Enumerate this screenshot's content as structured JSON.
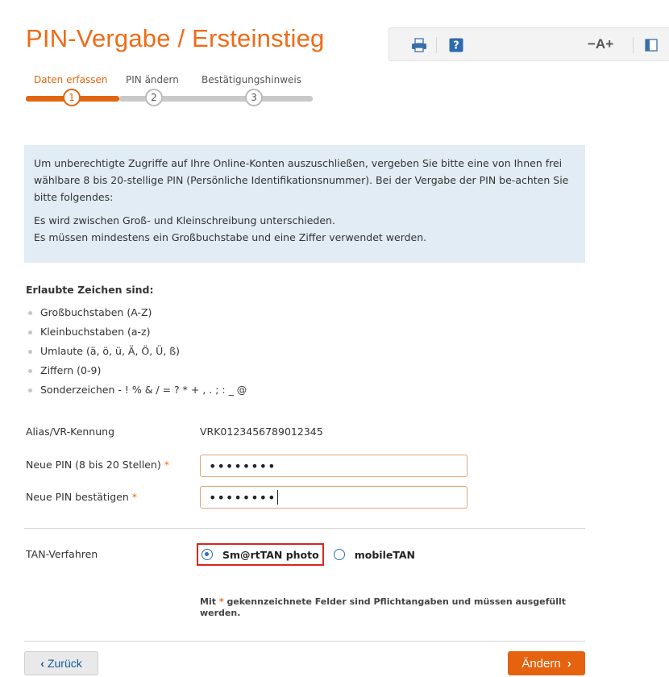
{
  "page": {
    "title": "PIN-Vergabe / Ersteinstieg"
  },
  "toolbar": {
    "font_size_control": "−A+",
    "icons": [
      "print-icon",
      "help-icon",
      "layout-icon"
    ]
  },
  "steps": [
    {
      "number": "1",
      "label": "Daten erfassen",
      "active": true
    },
    {
      "number": "2",
      "label": "PIN ändern",
      "active": false
    },
    {
      "number": "3",
      "label": "Bestätigungshinweis",
      "active": false
    }
  ],
  "info": {
    "paragraph1": "Um unberechtigte Zugriffe auf Ihre Online-Konten auszuschließen, vergeben Sie bitte eine von Ihnen frei wählbare 8 bis 20-stellige PIN (Persönliche Identifikationsnummer). Bei der Vergabe der PIN be-achten Sie bitte folgendes:",
    "line1": "Es wird zwischen Groß- und Kleinschreibung unterschieden.",
    "line2": "Es müssen mindestens ein Großbuchstabe und eine Ziffer verwendet werden."
  },
  "allowed": {
    "title": "Erlaubte Zeichen sind:",
    "items": [
      "Großbuchstaben (A-Z)",
      "Kleinbuchstaben (a-z)",
      "Umlaute (ä, ö, ü, Ä, Ö, Ü, ß)",
      "Ziffern (0-9)",
      "Sonderzeichen - ! % & / = ? * + , . ; : _ @"
    ]
  },
  "form": {
    "alias_label": "Alias/VR-Kennung",
    "alias_value": "VRK0123456789012345",
    "new_pin_label": "Neue PIN (8 bis 20 Stellen)",
    "new_pin_value": "••••••••",
    "confirm_pin_label": "Neue PIN bestätigen",
    "confirm_pin_value": "••••••••",
    "required_marker": "*",
    "tan_label": "TAN-Verfahren",
    "tan_options": [
      {
        "label": "Sm@rtTAN photo",
        "checked": true
      },
      {
        "label": "mobileTAN",
        "checked": false
      }
    ]
  },
  "note": {
    "prefix": "Mit",
    "marker": "*",
    "text": "gekennzeichnete Felder sind Pflichtangaben und müssen ausgefüllt werden."
  },
  "buttons": {
    "back_chevron": "‹",
    "back_label": "Zurück",
    "submit_label": "Ändern",
    "submit_chevron": "›"
  },
  "colors": {
    "accent": "#e5620f",
    "info_bg": "#e1ecf4",
    "radio": "#2c6fb6",
    "highlight": "#d9261c"
  }
}
